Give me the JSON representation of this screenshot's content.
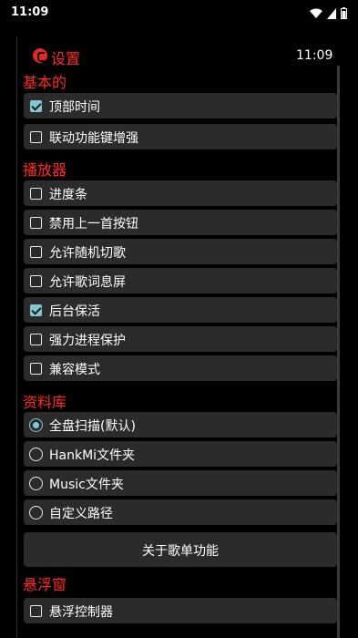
{
  "status_bar": {
    "time": "11:09"
  },
  "header": {
    "title": "设置",
    "clock": "11:09"
  },
  "sections": {
    "basic": "基本的",
    "player": "播放器",
    "library": "资料库",
    "float": "悬浮窗"
  },
  "basic_items": [
    {
      "label": "顶部时间",
      "checked": true
    },
    {
      "label": "联动功能键增强",
      "checked": false
    }
  ],
  "player_items": [
    {
      "label": "进度条",
      "checked": false
    },
    {
      "label": "禁用上一首按钮",
      "checked": false
    },
    {
      "label": "允许随机切歌",
      "checked": false
    },
    {
      "label": "允许歌词息屏",
      "checked": false
    },
    {
      "label": "后台保活",
      "checked": true
    },
    {
      "label": "强力进程保护",
      "checked": false
    },
    {
      "label": "兼容模式",
      "checked": false
    }
  ],
  "library_items": [
    {
      "label": "全盘扫描(默认)",
      "selected": true
    },
    {
      "label": "HankMi文件夹",
      "selected": false
    },
    {
      "label": "Music文件夹",
      "selected": false
    },
    {
      "label": "自定义路径",
      "selected": false
    }
  ],
  "about_playlist_button": "关于歌单功能",
  "float_items": [
    {
      "label": "悬浮控制器",
      "checked": false
    }
  ],
  "colors": {
    "accent": "#7fc9d3",
    "section_title": "#ff2a1e",
    "row_bg": "#2b2b2b"
  }
}
